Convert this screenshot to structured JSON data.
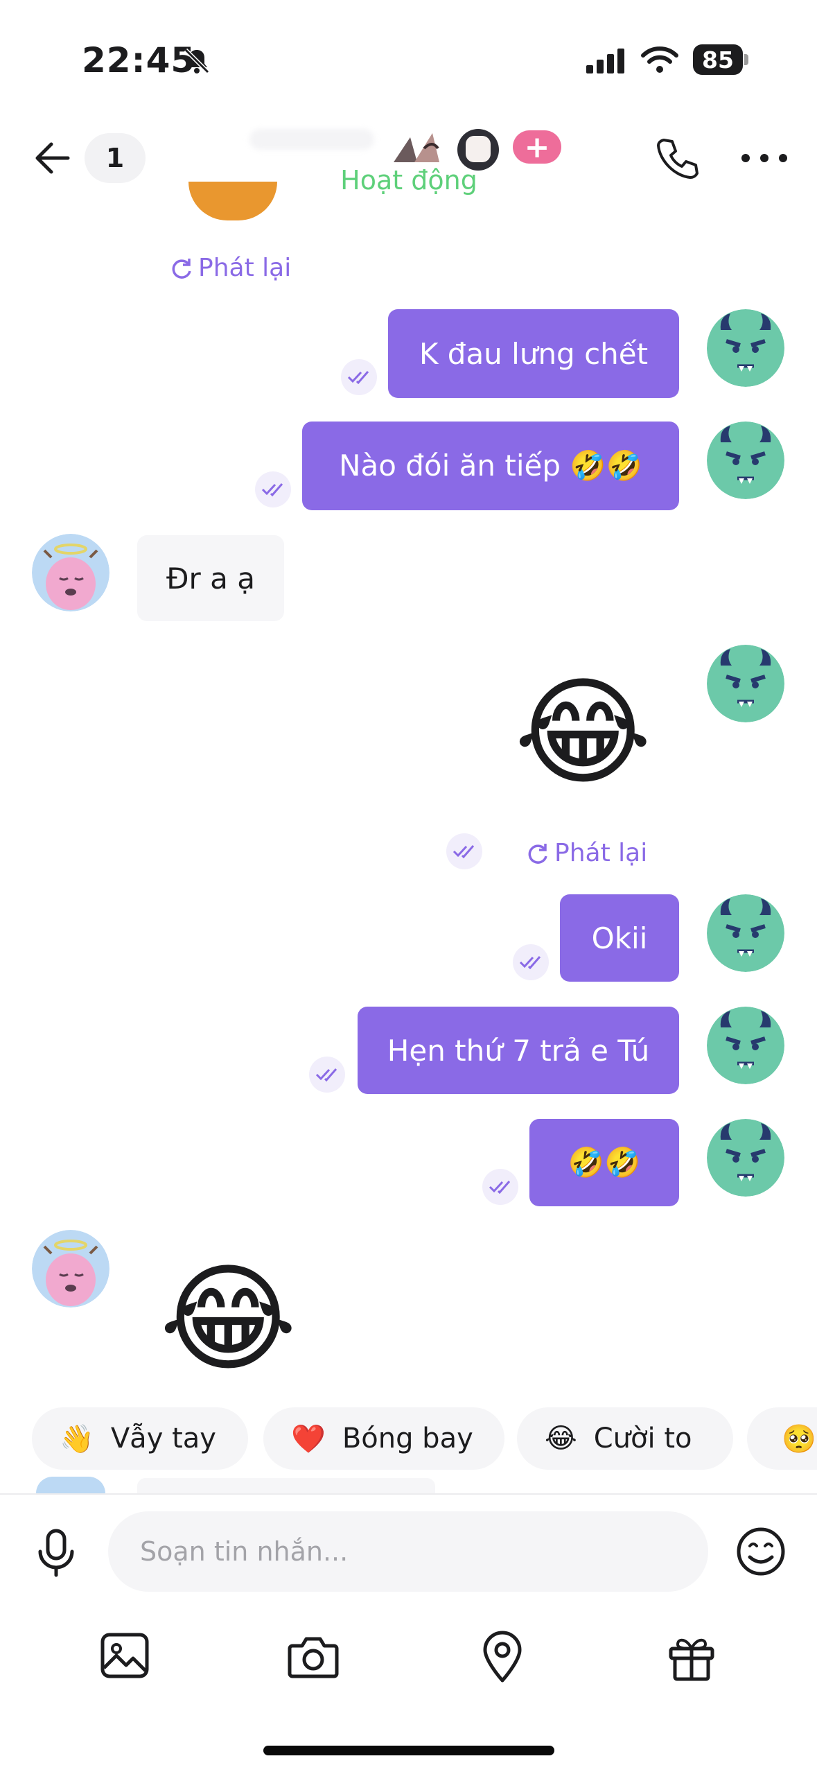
{
  "status_bar": {
    "time": "22:45",
    "battery": "85"
  },
  "header": {
    "unread_count": "1",
    "status": "Hoạt động",
    "add_label": "+"
  },
  "messages": {
    "replay_label": "Phát lại",
    "out_1": "K đau lưng chết",
    "out_2": "Nào đói ăn tiếp 🤣🤣",
    "in_1": "Đr a ạ",
    "out_emoji_1": "😂",
    "out_3": "Okii",
    "out_4": "Hẹn thứ 7 trả e Tú",
    "out_5": "🤣🤣",
    "in_emoji_1": "😂"
  },
  "quick_reactions": [
    {
      "emoji": "👋",
      "label": "Vẫy tay"
    },
    {
      "emoji": "❤️",
      "label": "Bóng bay"
    },
    {
      "emoji": "😂",
      "label": "Cười to"
    },
    {
      "emoji": "🥺",
      "label": ""
    }
  ],
  "composer": {
    "placeholder": "Soạn tin nhắn..."
  },
  "colors": {
    "accent": "#8a6ae6",
    "active_green": "#5ed07a",
    "pink": "#ee6d9a"
  }
}
